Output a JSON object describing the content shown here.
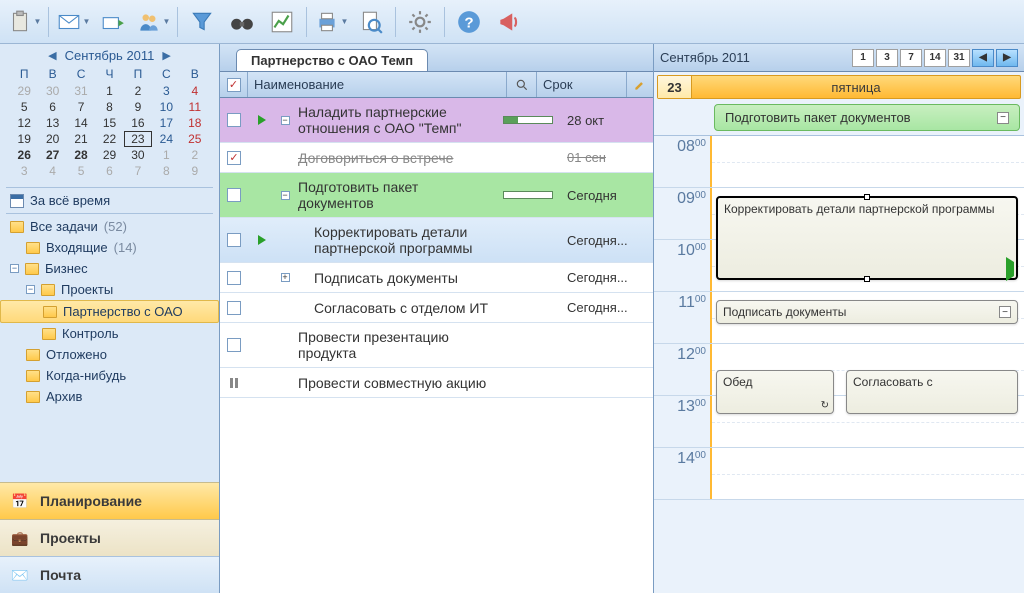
{
  "toolbar_icons": [
    "clipboard",
    "mail",
    "mail-reply",
    "users",
    "funnel",
    "binoculars",
    "chart",
    "printer",
    "print-preview",
    "gear",
    "help",
    "announce"
  ],
  "calendar": {
    "title": "Сентябрь 2011",
    "dow": [
      "П",
      "В",
      "С",
      "Ч",
      "П",
      "С",
      "В"
    ],
    "weeks": [
      [
        {
          "d": "29",
          "g": true
        },
        {
          "d": "30",
          "g": true
        },
        {
          "d": "31",
          "g": true
        },
        {
          "d": "1"
        },
        {
          "d": "2"
        },
        {
          "d": "3",
          "b": true
        },
        {
          "d": "4",
          "r": true
        }
      ],
      [
        {
          "d": "5"
        },
        {
          "d": "6"
        },
        {
          "d": "7"
        },
        {
          "d": "8"
        },
        {
          "d": "9"
        },
        {
          "d": "10",
          "b": true
        },
        {
          "d": "11",
          "r": true
        }
      ],
      [
        {
          "d": "12"
        },
        {
          "d": "13"
        },
        {
          "d": "14"
        },
        {
          "d": "15"
        },
        {
          "d": "16"
        },
        {
          "d": "17",
          "b": true
        },
        {
          "d": "18",
          "r": true
        }
      ],
      [
        {
          "d": "19"
        },
        {
          "d": "20"
        },
        {
          "d": "21"
        },
        {
          "d": "22"
        },
        {
          "d": "23",
          "t": true
        },
        {
          "d": "24",
          "b": true
        },
        {
          "d": "25",
          "r": true
        }
      ],
      [
        {
          "d": "26",
          "bd": true
        },
        {
          "d": "27",
          "bd": true
        },
        {
          "d": "28",
          "bd": true
        },
        {
          "d": "29"
        },
        {
          "d": "30"
        },
        {
          "d": "1",
          "g": true
        },
        {
          "d": "2",
          "g": true
        }
      ],
      [
        {
          "d": "3",
          "g": true
        },
        {
          "d": "4",
          "g": true
        },
        {
          "d": "5",
          "g": true
        },
        {
          "d": "6",
          "g": true
        },
        {
          "d": "7",
          "g": true
        },
        {
          "d": "8",
          "g": true
        },
        {
          "d": "9",
          "g": true
        }
      ]
    ]
  },
  "sidebar": {
    "alltime": "За всё время",
    "all_tasks": "Все задачи",
    "all_tasks_count": "(52)",
    "inbox": "Входящие",
    "inbox_count": "(14)",
    "business": "Бизнес",
    "projects": "Проекты",
    "partnership": "Партнерство с ОАО",
    "control": "Контроль",
    "deferred": "Отложено",
    "someday": "Когда-нибудь",
    "archive": "Архив"
  },
  "nav": {
    "planning": "Планирование",
    "projects": "Проекты",
    "mail": "Почта"
  },
  "tab_title": "Партнерство с ОАО Темп",
  "grid": {
    "col_name": "Наименование",
    "col_date": "Срок"
  },
  "tasks": [
    {
      "name": "Наладить партнерские отношения с ОАО \"Темп\"",
      "date": "28 окт",
      "bg": "purple",
      "play": true,
      "tree": "-",
      "prog": 30
    },
    {
      "name": "Договориться о встрече",
      "date": "01 сен",
      "done": true,
      "checked": true
    },
    {
      "name": "Подготовить пакет документов",
      "date": "Сегодня",
      "bg": "green",
      "tree": "-",
      "prog": 0
    },
    {
      "name": "Корректировать детали партнерской программы",
      "date": "Сегодня...",
      "sel": true,
      "play": true,
      "indent": 1
    },
    {
      "name": "Подписать документы",
      "date": "Сегодня...",
      "tree": "+",
      "indent": 1
    },
    {
      "name": "Согласовать с отделом ИТ",
      "date": "Сегодня...",
      "indent": 1
    },
    {
      "name": "Провести презентацию продукта",
      "date": ""
    },
    {
      "name": "Провести совместную акцию",
      "date": "",
      "pause": true
    }
  ],
  "right": {
    "title": "Сентябрь 2011",
    "views": [
      "1",
      "3",
      "7",
      "14",
      "31"
    ],
    "day_num": "23",
    "day_name": "пятница",
    "allday_event": "Подготовить пакет документов",
    "hours": [
      "08",
      "09",
      "10",
      "11",
      "12",
      "13",
      "14"
    ],
    "events": {
      "e1": "Корректировать детали партнерской программы",
      "e2": "Подписать документы",
      "e3": "Обед",
      "e4": "Согласовать с"
    }
  }
}
